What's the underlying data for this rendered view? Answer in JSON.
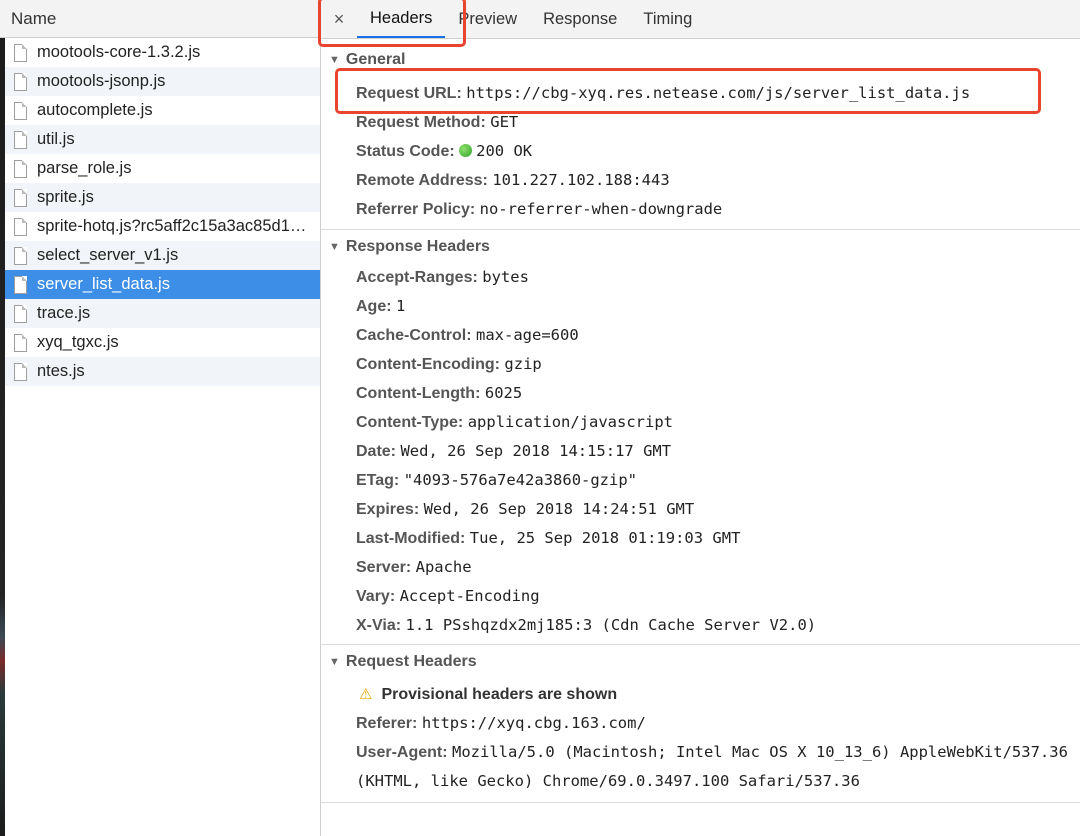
{
  "left_panel": {
    "column_header": "Name",
    "files": [
      {
        "name": "mootools-core-1.3.2.js",
        "selected": false
      },
      {
        "name": "mootools-jsonp.js",
        "selected": false
      },
      {
        "name": "autocomplete.js",
        "selected": false
      },
      {
        "name": "util.js",
        "selected": false
      },
      {
        "name": "parse_role.js",
        "selected": false
      },
      {
        "name": "sprite.js",
        "selected": false
      },
      {
        "name": "sprite-hotq.js?rc5aff2c15a3ac85d1…",
        "selected": false
      },
      {
        "name": "select_server_v1.js",
        "selected": false
      },
      {
        "name": "server_list_data.js",
        "selected": true
      },
      {
        "name": "trace.js",
        "selected": false
      },
      {
        "name": "xyq_tgxc.js",
        "selected": false
      },
      {
        "name": "ntes.js",
        "selected": false
      }
    ]
  },
  "tabs": {
    "close": "×",
    "items": [
      "Headers",
      "Preview",
      "Response",
      "Timing"
    ],
    "active": "Headers"
  },
  "general": {
    "title": "General",
    "request_url_key": "Request URL:",
    "request_url": "https://cbg-xyq.res.netease.com/js/server_list_data.js",
    "request_method_key": "Request Method:",
    "request_method": "GET",
    "status_code_key": "Status Code:",
    "status_code": "200 OK",
    "remote_address_key": "Remote Address:",
    "remote_address": "101.227.102.188:443",
    "referrer_policy_key": "Referrer Policy:",
    "referrer_policy": "no-referrer-when-downgrade"
  },
  "response_headers": {
    "title": "Response Headers",
    "items": [
      {
        "key": "Accept-Ranges:",
        "value": "bytes"
      },
      {
        "key": "Age:",
        "value": "1"
      },
      {
        "key": "Cache-Control:",
        "value": "max-age=600"
      },
      {
        "key": "Content-Encoding:",
        "value": "gzip"
      },
      {
        "key": "Content-Length:",
        "value": "6025"
      },
      {
        "key": "Content-Type:",
        "value": "application/javascript"
      },
      {
        "key": "Date:",
        "value": "Wed, 26 Sep 2018 14:15:17 GMT"
      },
      {
        "key": "ETag:",
        "value": "\"4093-576a7e42a3860-gzip\""
      },
      {
        "key": "Expires:",
        "value": "Wed, 26 Sep 2018 14:24:51 GMT"
      },
      {
        "key": "Last-Modified:",
        "value": "Tue, 25 Sep 2018 01:19:03 GMT"
      },
      {
        "key": "Server:",
        "value": "Apache"
      },
      {
        "key": "Vary:",
        "value": "Accept-Encoding"
      },
      {
        "key": "X-Via:",
        "value": "1.1 PSshqzdx2mj185:3 (Cdn Cache Server V2.0)"
      }
    ]
  },
  "request_headers": {
    "title": "Request Headers",
    "warning": "Provisional headers are shown",
    "referer_key": "Referer:",
    "referer": "https://xyq.cbg.163.com/",
    "user_agent_key": "User-Agent:",
    "user_agent": "Mozilla/5.0 (Macintosh; Intel Mac OS X 10_13_6) AppleWebKit/537.36 (KHTML, like Gecko) Chrome/69.0.3497.100 Safari/537.36"
  },
  "colors": {
    "selected_row": "#3d8ee6",
    "highlight_box": "#e8442e",
    "active_tab_underline": "#1a73e8",
    "status_ok": "#2fa32b"
  }
}
